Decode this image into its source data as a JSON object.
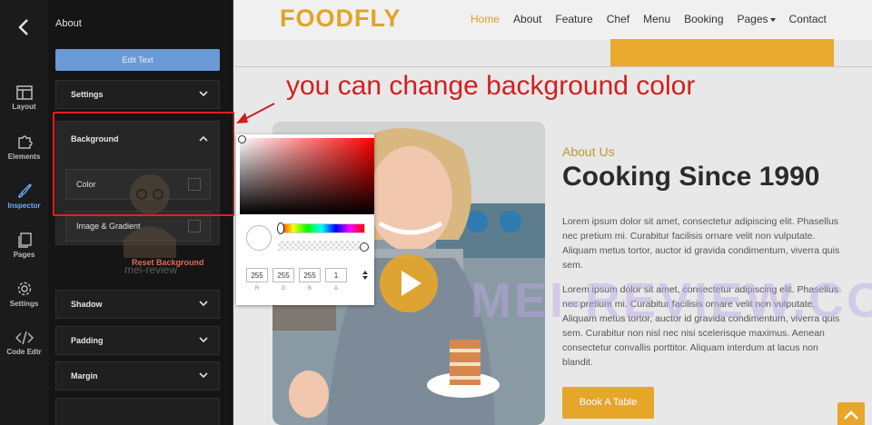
{
  "rail": {
    "items": [
      {
        "label": "Layout"
      },
      {
        "label": "Elements"
      },
      {
        "label": "Inspector"
      },
      {
        "label": "Pages"
      },
      {
        "label": "Settings"
      },
      {
        "label": "Code Edtr"
      }
    ]
  },
  "panel": {
    "title": "About",
    "edit_text_label": "Edit Text",
    "sections": {
      "settings": "Settings",
      "background": "Background",
      "color": "Color",
      "image_gradient": "Image & Gradient",
      "reset_background": "Reset Background",
      "shadow": "Shadow",
      "padding": "Padding",
      "margin": "Margin"
    },
    "watermark_text": "mei-review"
  },
  "annotation": "you can change background color",
  "color_picker": {
    "r": "255",
    "g": "255",
    "b": "255",
    "a": "1",
    "labels": {
      "r": "R",
      "g": "G",
      "b": "B",
      "a": "A"
    }
  },
  "site": {
    "logo": "FOODFLY",
    "nav": [
      "Home",
      "About",
      "Feature",
      "Chef",
      "Menu",
      "Booking",
      "Pages",
      "Contact"
    ],
    "active_nav": "Home",
    "about_label": "About Us",
    "about_title": "Cooking Since 1990",
    "paragraph1": "Lorem ipsum dolor sit amet, consectetur adipiscing elit. Phasellus nec pretium mi. Curabitur facilisis ornare velit non vulputate. Aliquam metus tortor, auctor id gravida condimentum, viverra quis sem.",
    "paragraph2": "Lorem ipsum dolor sit amet, consectetur adipiscing elit. Phasellus nec pretium mi. Curabitur facilisis ornare velit non vulputate. Aliquam metus tortor, auctor id gravida condimentum, viverra quis sem. Curabitur non nisl nec nisi scelerisque maximus. Aenean consectetur convallis porttitor. Aliquam interdum at lacus non blandit.",
    "book_button": "Book A Table",
    "watermark_big": "MEI-REVIEW.COM"
  },
  "colors": {
    "accent": "#e6a62a",
    "highlight": "#e4201a",
    "annotation": "#d11f1f",
    "inspector_active": "#6fa8ff"
  }
}
